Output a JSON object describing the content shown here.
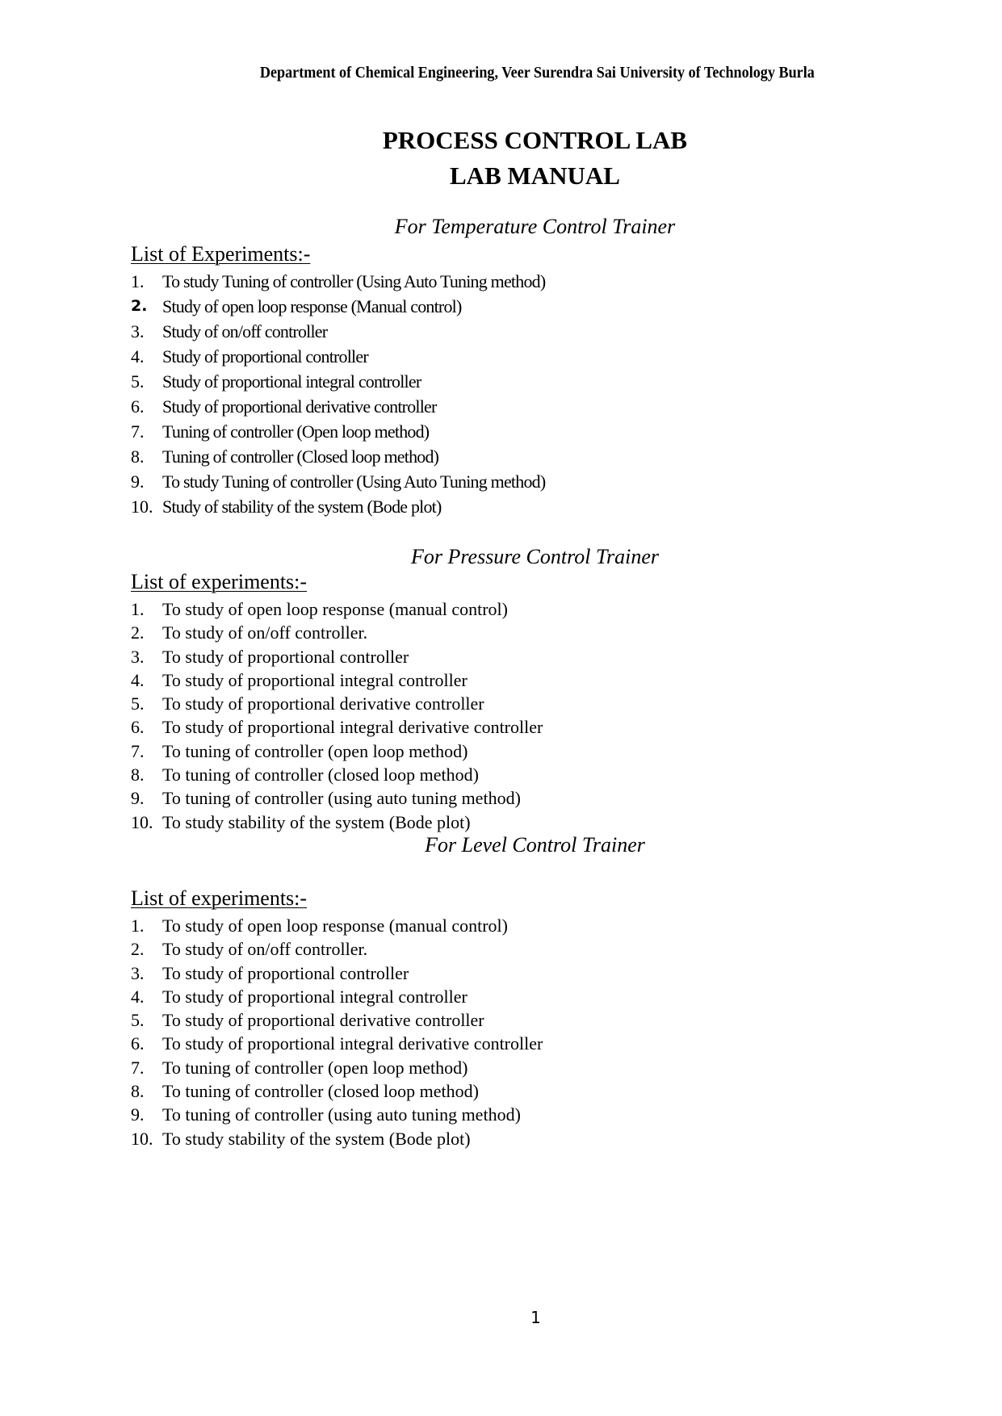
{
  "header": "Department of Chemical Engineering, Veer Surendra Sai University of Technology Burla",
  "title_line1": "PROCESS CONTROL LAB",
  "title_line2": "LAB MANUAL",
  "sections": [
    {
      "subtitle": "For Temperature Control Trainer",
      "list_heading": "List of Experiments:-",
      "items": [
        {
          "num": "1.",
          "text": "To study Tuning of controller (Using Auto Tuning method)"
        },
        {
          "num": "2.",
          "text": "Study of open loop response (Manual control)"
        },
        {
          "num": "3.",
          "text": "Study of on/off controller"
        },
        {
          "num": "4.",
          "text": "Study of proportional controller"
        },
        {
          "num": "5.",
          "text": "Study of proportional integral controller"
        },
        {
          "num": "6.",
          "text": "Study of proportional derivative controller"
        },
        {
          "num": "7.",
          "text": "Tuning of controller (Open loop method)"
        },
        {
          "num": "8.",
          "text": "Tuning of controller (Closed loop method)"
        },
        {
          "num": "9.",
          "text": "To study Tuning of controller (Using Auto Tuning method)"
        },
        {
          "num": "10.",
          "text": "Study of stability of the system (Bode plot)"
        }
      ]
    },
    {
      "subtitle": "For Pressure Control Trainer",
      "list_heading": "List of experiments:-",
      "items": [
        {
          "num": "1.",
          "text": "To study of open loop response (manual control)"
        },
        {
          "num": "2.",
          "text": "To study of on/off controller."
        },
        {
          "num": "3.",
          "text": "To study of proportional controller"
        },
        {
          "num": "4.",
          "text": "To study of proportional integral controller"
        },
        {
          "num": "5.",
          "text": "To study of proportional derivative controller"
        },
        {
          "num": "6.",
          "text": "To study of proportional integral derivative controller"
        },
        {
          "num": "7.",
          "text": "To tuning of controller (open loop method)"
        },
        {
          "num": "8.",
          "text": "To tuning of controller (closed loop method)"
        },
        {
          "num": "9.",
          "text": "To tuning of controller (using auto tuning method)"
        },
        {
          "num": "10.",
          "text": "To study stability of the system (Bode plot)"
        }
      ]
    },
    {
      "subtitle": "For Level Control Trainer",
      "list_heading": "List of experiments:-",
      "items": [
        {
          "num": "1.",
          "text": "To study of open loop response (manual control)"
        },
        {
          "num": "2.",
          "text": "To study of on/off controller."
        },
        {
          "num": "3.",
          "text": "To study of proportional controller"
        },
        {
          "num": "4.",
          "text": "To study of proportional integral controller"
        },
        {
          "num": "5.",
          "text": "To study of proportional derivative controller"
        },
        {
          "num": "6.",
          "text": "To study of proportional integral derivative controller"
        },
        {
          "num": "7.",
          "text": "To tuning of controller (open loop method)"
        },
        {
          "num": "8.",
          "text": "To tuning of controller (closed loop method)"
        },
        {
          "num": "9.",
          "text": "To tuning of controller (using auto tuning method)"
        },
        {
          "num": "10.",
          "text": "To study stability of the system (Bode plot)"
        }
      ]
    }
  ],
  "page_number": "1"
}
